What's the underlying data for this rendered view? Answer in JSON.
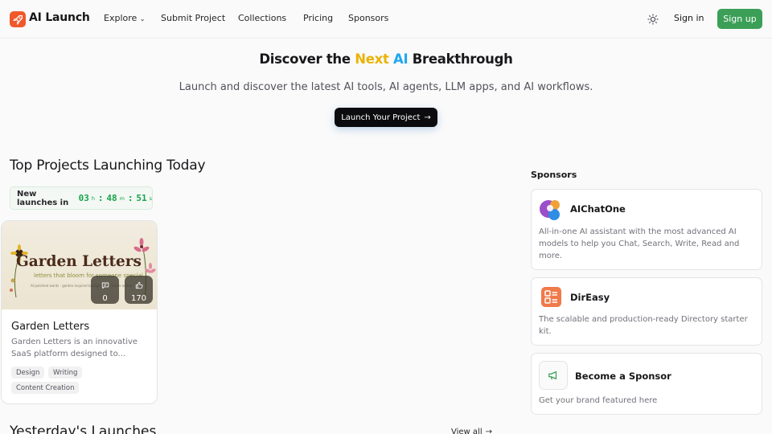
{
  "nav": {
    "brand": "AI Launch",
    "links": [
      "Explore",
      "Submit Project",
      "Collections",
      "Pricing",
      "Sponsors"
    ],
    "sign_in": "Sign in",
    "sign_up": "Sign up"
  },
  "hero": {
    "title_before": "Discover the ",
    "title_next": "Next",
    "title_ai": " AI",
    "title_after": " Breakthrough",
    "subtitle": "Launch and discover the latest AI tools, AI agents, LLM apps, and AI workflows.",
    "cta": "Launch Your Project"
  },
  "today": {
    "title": "Top Projects Launching Today",
    "countdown_label": "New launches in",
    "hours": "03",
    "minutes": "48",
    "seconds": "51",
    "unit_h": "h",
    "unit_m": "m",
    "unit_s": "s"
  },
  "project": {
    "name": "Garden Letters",
    "description": "Garden Letters is an innovative SaaS platform designed to...",
    "image_title": "Garden Letters",
    "image_tagline": "letters that bloom for someone special",
    "image_small": "AI-polished words · garden-inspired backgrounds · share online",
    "comments": "0",
    "upvotes": "170",
    "tags": [
      "Design",
      "Writing",
      "Content Creation"
    ]
  },
  "yesterday": {
    "title": "Yesterday's Launches",
    "view_all": "View all"
  },
  "sponsors": {
    "heading": "Sponsors",
    "items": [
      {
        "name": "AIChatOne",
        "description": "All-in-one AI assistant with the most advanced AI models to help you Chat, Search, Write, Read and more."
      },
      {
        "name": "DirEasy",
        "description": "The scalable and production-ready Directory starter kit."
      },
      {
        "name": "Become a Sponsor",
        "description": "Get your brand featured here"
      }
    ]
  },
  "colors": {
    "accent_green": "#3b9f57",
    "logo_orange": "#f0592b",
    "next_yellow": "#eab308",
    "ai_blue": "#22a6ef"
  }
}
